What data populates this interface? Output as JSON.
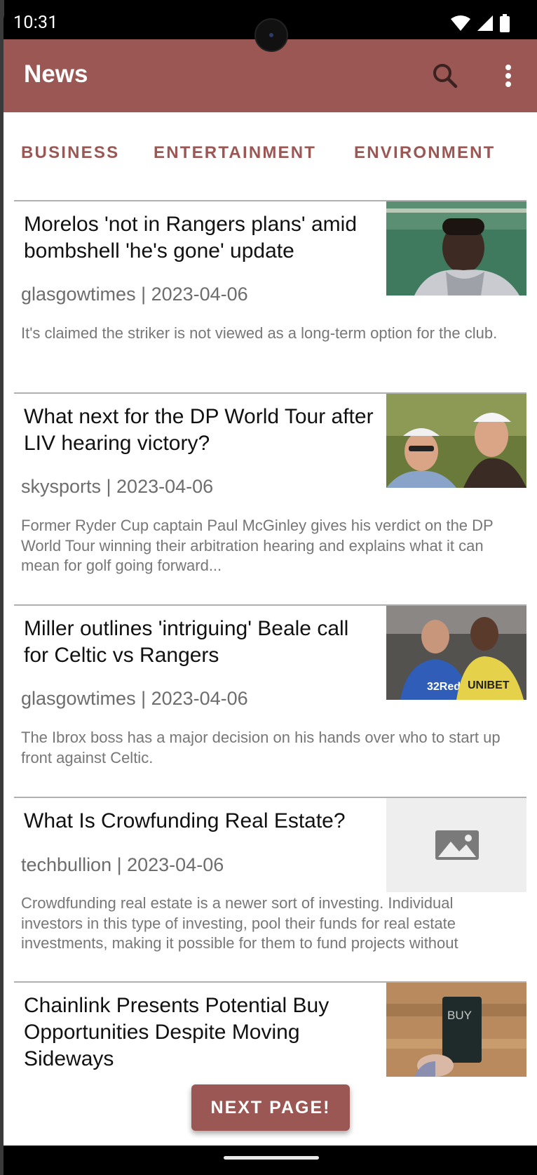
{
  "status": {
    "time": "10:31",
    "icons": [
      "wifi-icon",
      "signal-icon",
      "battery-icon"
    ]
  },
  "app_bar": {
    "title": "News",
    "icons": [
      "search-icon",
      "more-vert-icon"
    ],
    "color": "#9b5753"
  },
  "tabs": [
    {
      "label": "BUSINESS"
    },
    {
      "label": "ENTERTAINMENT"
    },
    {
      "label": "ENVIRONMENT"
    }
  ],
  "articles": [
    {
      "title": "Morelos 'not in Rangers plans' amid bombshell 'he's gone' update",
      "meta": "glasgowtimes | 2023-04-06",
      "description": "It's claimed the striker is not viewed as a long-term option for the club.",
      "image": "player-photo"
    },
    {
      "title": "What next for the DP World Tour after LIV hearing victory?",
      "meta": "skysports | 2023-04-06",
      "description": "Former Ryder Cup captain Paul McGinley gives his verdict on the DP World Tour winning their arbitration hearing and explains what it can mean for golf going forward...",
      "image": "golfers-photo"
    },
    {
      "title": "Miller outlines 'intriguing' Beale call for Celtic vs Rangers",
      "meta": "glasgowtimes | 2023-04-06",
      "description": "The Ibrox boss has a major decision on his hands over who to start up front against Celtic.",
      "image": "footballers-photo"
    },
    {
      "title": "What Is Crowfunding Real Estate?",
      "meta": "techbullion | 2023-04-06",
      "description": "Crowdfunding real estate is a newer sort of investing. Individual investors in this type of investing, pool their funds for real estate investments, making it possible for them to fund projects without",
      "image": "image-placeholder-icon"
    },
    {
      "title": "Chainlink Presents Potential Buy Opportunities Despite Moving Sideways",
      "meta": "",
      "description": "",
      "image": "buy-card-photo",
      "image_text": "BUY"
    }
  ],
  "next_button": {
    "label": "NEXT PAGE!"
  }
}
